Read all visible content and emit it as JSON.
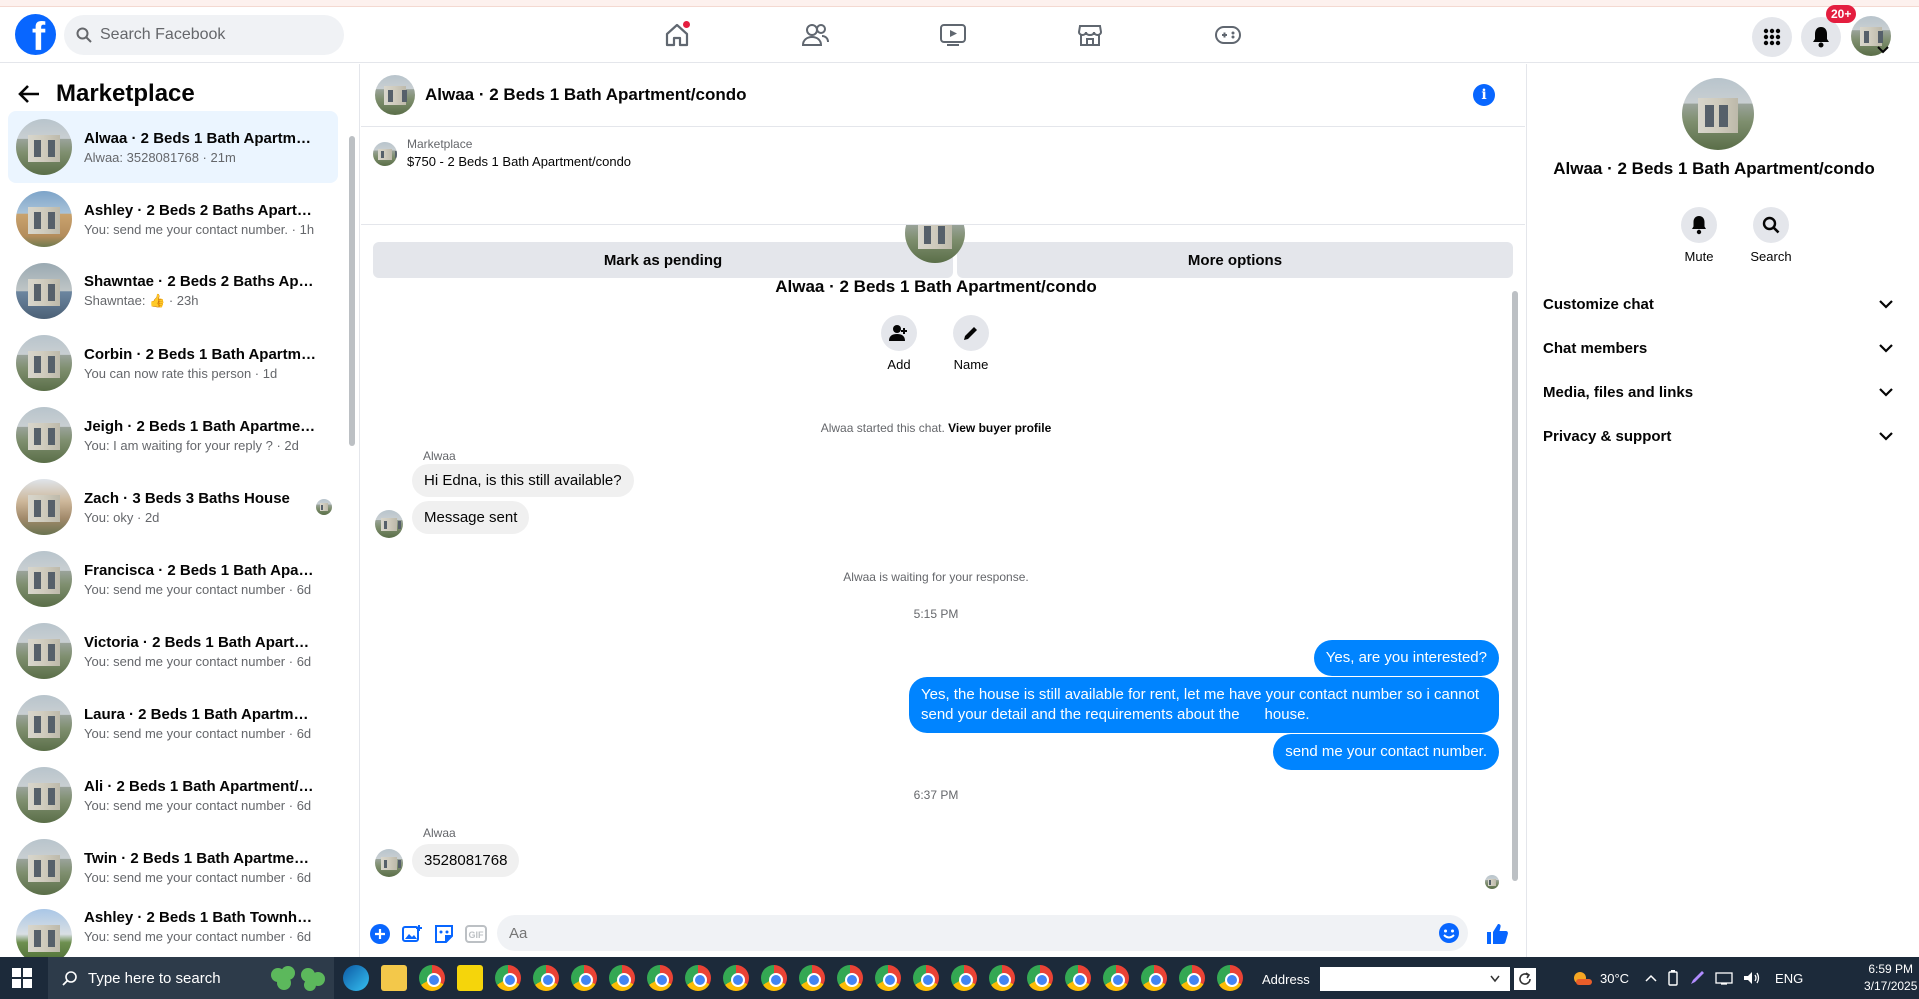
{
  "topbar": {
    "search_placeholder": "Search Facebook",
    "notification_badge": "20+",
    "accent": "#0866ff"
  },
  "sidebar": {
    "title": "Marketplace",
    "conversations": [
      {
        "title": "Alwaa · 2 Beds 1 Bath Apartmen...",
        "subtitle": "Alwaa: 3528081768 · 21m",
        "active": true
      },
      {
        "title": "Ashley · 2 Beds 2 Baths Apartme...",
        "subtitle": "You: send me your contact number. · 1h"
      },
      {
        "title": "Shawntae · 2 Beds 2 Baths Apart...",
        "subtitle": "Shawntae: 👍 · 23h"
      },
      {
        "title": "Corbin · 2 Beds 1 Bath Apartmen...",
        "subtitle": "You can now rate this person · 1d"
      },
      {
        "title": "Jeigh · 2 Beds 1 Bath Apartment...",
        "subtitle": "You: I am waiting for your reply ? · 2d"
      },
      {
        "title": "Zach · 3 Beds 3 Baths House",
        "subtitle": "You: oky · 2d"
      },
      {
        "title": "Francisca · 2 Beds 1 Bath Apartm...",
        "subtitle": "You: send me your contact number · 6d"
      },
      {
        "title": "Victoria · 2 Beds 1 Bath Apartme...",
        "subtitle": "You: send me your contact number · 6d"
      },
      {
        "title": "Laura · 2 Beds 1 Bath Apartment...",
        "subtitle": "You: send me your contact number · 6d"
      },
      {
        "title": "Ali · 2 Beds 1 Bath Apartment/co...",
        "subtitle": "You: send me your contact number · 6d"
      },
      {
        "title": "Twin · 2 Beds 1 Bath Apartment/...",
        "subtitle": "You: send me your contact number · 6d"
      },
      {
        "title": "Ashley · 2 Beds 1 Bath Townhouse",
        "subtitle": "You: send me your contact number · 6d"
      }
    ]
  },
  "chat": {
    "title": "Alwaa · 2 Beds 1 Bath Apartment/condo",
    "listing_source": "Marketplace",
    "listing_desc": "$750 - 2 Beds 1 Bath Apartment/condo",
    "mark_pending_label": "Mark as pending",
    "more_options_label": "More options",
    "add_label": "Add",
    "name_label": "Name",
    "started_text": "Alwaa started this chat.",
    "view_profile_label": "View buyer profile",
    "sender_name": "Alwaa",
    "msg1": "Hi Edna, is this still available?",
    "msg2": "Message sent",
    "waiting_text": "Alwaa is waiting for your response.",
    "time1": "5:15 PM",
    "out1": "Yes, are you interested?",
    "out2_line1": "Yes, the house is still available for rent, let me have your contact number so i cannot",
    "out2_line2": "send your detail and the requirements about the      house.",
    "out3": "send me your contact number.",
    "time2": "6:37 PM",
    "msg3": "3528081768",
    "composer_placeholder": "Aa",
    "outgoing_color": "#0084ff"
  },
  "details": {
    "title": "Alwaa · 2 Beds 1 Bath Apartment/condo",
    "mute_label": "Mute",
    "search_label": "Search",
    "sections": [
      "Customize chat",
      "Chat members",
      "Media, files and links",
      "Privacy & support"
    ]
  },
  "taskbar": {
    "search_placeholder": "Type here to search",
    "address_label": "Address",
    "temperature": "30°C",
    "language": "ENG",
    "time": "6:59 PM",
    "date": "3/17/2025"
  }
}
